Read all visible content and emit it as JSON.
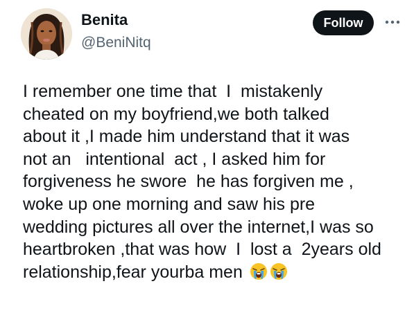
{
  "author": {
    "display_name": "Benita",
    "handle": "@BeniNitq"
  },
  "actions": {
    "follow_label": "Follow",
    "more_icon": "more-horizontal-icon"
  },
  "tweet": {
    "lines": [
      "I remember one time that  I  mistakenly",
      "cheated on my boyfriend,we both talked",
      "about it ,I made him understand that it was",
      "not an   intentional  act , I asked him for",
      "forgiveness he swore  he has forgiven me ,",
      "woke up one morning and saw his pre",
      "wedding pictures all over the internet,I was so",
      "heartbroken ,that was how  I  lost a  2years old",
      "relationship,fear yourba men "
    ],
    "emojis": [
      "loudly-crying-face-emoji",
      "loudly-crying-face-emoji"
    ]
  },
  "colors": {
    "text_primary": "#0f1419",
    "text_secondary": "#536471",
    "follow_button_bg": "#0f1419",
    "follow_button_text": "#ffffff",
    "background": "#ffffff"
  }
}
